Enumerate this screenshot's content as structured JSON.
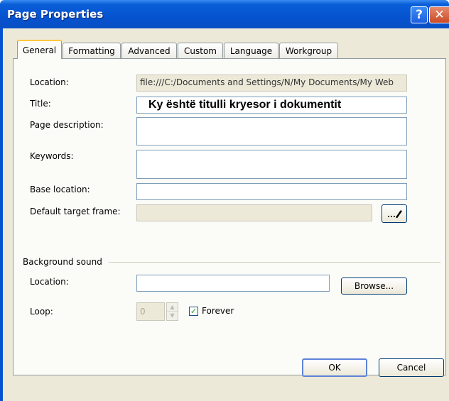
{
  "window": {
    "title": "Page Properties",
    "help_label": "?",
    "close_label": "✕"
  },
  "tabs": [
    {
      "label": "General",
      "active": true
    },
    {
      "label": "Formatting",
      "active": false
    },
    {
      "label": "Advanced",
      "active": false
    },
    {
      "label": "Custom",
      "active": false
    },
    {
      "label": "Language",
      "active": false
    },
    {
      "label": "Workgroup",
      "active": false
    }
  ],
  "general": {
    "location_label": "Location:",
    "location_value": "file:///C:/Documents and Settings/N/My Documents/My Web",
    "title_label": "Title:",
    "title_value": "Ky është titulli kryesor i dokumentit",
    "description_label": "Page description:",
    "description_value": "",
    "keywords_label": "Keywords:",
    "keywords_value": "",
    "base_location_label": "Base location:",
    "base_location_value": "",
    "target_frame_label": "Default target frame:",
    "target_frame_value": "",
    "target_frame_button_icon": "pencil-icon"
  },
  "background_sound": {
    "group_label": "Background sound",
    "location_label": "Location:",
    "location_value": "",
    "browse_label": "Browse...",
    "loop_label": "Loop:",
    "loop_value": "0",
    "forever_label": "Forever",
    "forever_checked": true
  },
  "footer": {
    "ok_label": "OK",
    "cancel_label": "Cancel"
  }
}
